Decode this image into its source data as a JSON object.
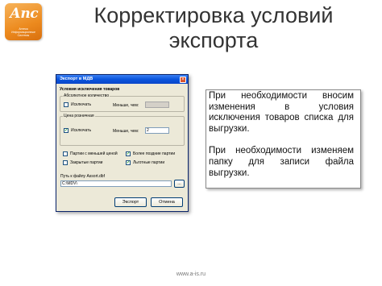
{
  "slide": {
    "title": "Корректировка условий экспорта"
  },
  "logo": {
    "mark": "Апс",
    "subtitle": "Аптека Информационные Системы"
  },
  "dialog": {
    "title": "Экспорт в МДВ",
    "section_title": "Условия исключения товаров",
    "group_quantity": {
      "legend": "Абсолютное количество",
      "checkbox_label": "Исключать",
      "less_than_label": "Меньше, чем:",
      "value": ""
    },
    "group_price": {
      "legend": "Цена розничная",
      "checkbox_label": "Исключать",
      "less_than_label": "Меньше, чем:",
      "value": "2"
    },
    "options": {
      "batches_smaller_price": "Партии с меньшей ценой",
      "later_batches": "Более поздние партии",
      "closed_batches": "Закрытые партии",
      "discount_batches": "Льготные партии"
    },
    "path_label": "Путь к файлу Assort.dbf",
    "path_value": "C:\\MDV\\",
    "browse_label": "...",
    "export_button": "Экспорт",
    "cancel_button": "Отмена"
  },
  "callout": {
    "paragraph1": "При необходимости вносим изменения в условия исключения товаров списка для выгрузки.",
    "paragraph2": "При необходимости изменяем папку для записи файла выгрузки."
  },
  "footer": {
    "url": "www.a-is.ru"
  }
}
